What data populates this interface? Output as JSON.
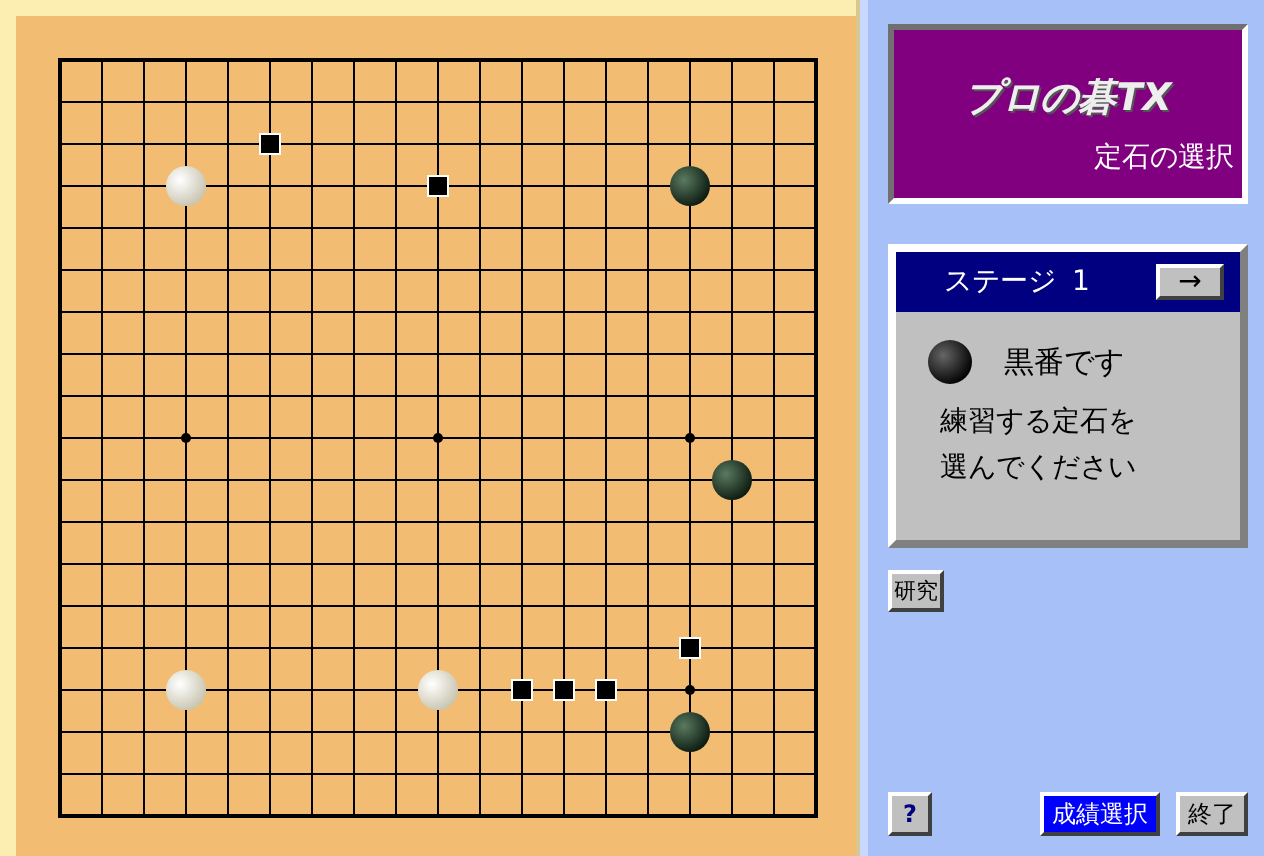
{
  "board": {
    "stones": [
      {
        "kind": "white"
      },
      {
        "kind": "black"
      },
      {
        "kind": "black"
      },
      {
        "kind": "white"
      },
      {
        "kind": "white"
      },
      {
        "kind": "black"
      }
    ]
  },
  "title": {
    "logo": "プロの碁TX",
    "subtitle": "定石の選択"
  },
  "stage_panel": {
    "label": "ステージ",
    "number": "1",
    "next_button": "→",
    "turn": {
      "kind": "black",
      "text": "黒番です"
    },
    "message_lines": [
      "練習する定石を",
      "選んでください"
    ]
  },
  "research_button": "研究",
  "buttons": [
    {
      "label": "?",
      "kind": "help"
    },
    {
      "label": "成績選択",
      "kind": "primary"
    },
    {
      "label": "終了",
      "kind": "plain"
    }
  ]
}
